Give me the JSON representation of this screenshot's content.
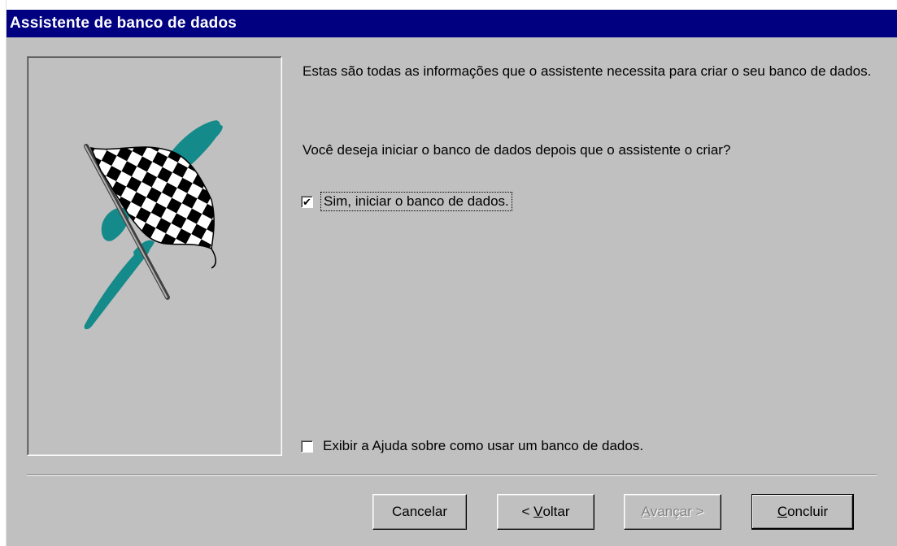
{
  "window": {
    "title": "Assistente de banco de dados"
  },
  "content": {
    "intro_text": "Estas são todas as informações que o assistente necessita para criar o seu banco de dados.",
    "question_text": "Você deseja iniciar o banco de dados depois que o assistente o criar?"
  },
  "options": {
    "start_db": {
      "label": "Sim, iniciar o banco de dados.",
      "checked": true,
      "mark": "✔"
    },
    "show_help": {
      "label": "Exibir a Ajuda sobre como usar um banco de dados.",
      "checked": false
    }
  },
  "buttons": {
    "cancel": "Cancelar",
    "back_prefix": "< ",
    "back_mnemonic": "V",
    "back_rest": "oltar",
    "next_mnemonic": "A",
    "next_rest": "vançar >",
    "finish_mnemonic": "C",
    "finish_rest": "oncluir"
  },
  "colors": {
    "titlebar": "#000080",
    "dialog_bg": "#c0c0c0",
    "flag_teal": "#158a8a"
  },
  "icons": {
    "illustration": "checkered-flag-icon"
  }
}
